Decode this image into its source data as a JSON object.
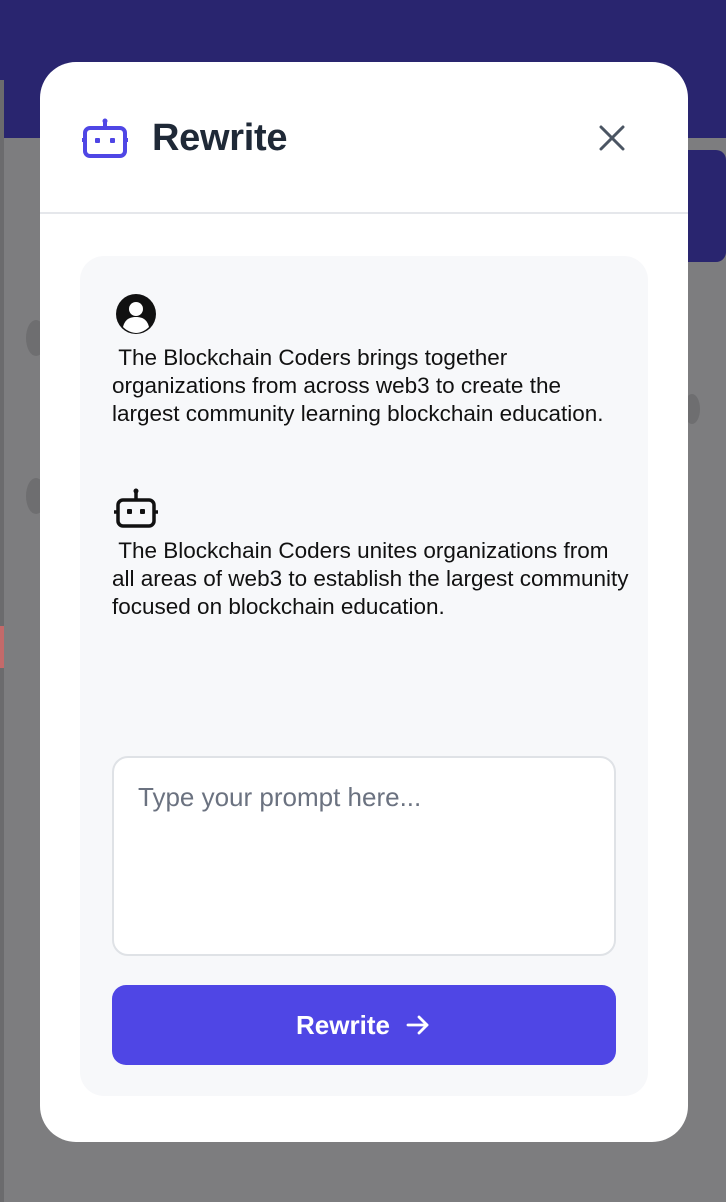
{
  "modal": {
    "title": "Rewrite",
    "close_icon": "close-icon",
    "header_icon": "robot-icon"
  },
  "conversation": [
    {
      "role": "user",
      "icon": "user-avatar-icon",
      "text": " The Blockchain Coders brings together organizations from across web3 to create the largest community learning blockchain education."
    },
    {
      "role": "assistant",
      "icon": "robot-icon",
      "text": " The Blockchain Coders unites organizations from all areas of web3 to establish the largest community focused on blockchain education."
    }
  ],
  "prompt": {
    "placeholder": "Type your prompt here...",
    "value": ""
  },
  "submit": {
    "label": "Rewrite",
    "icon": "arrow-right-icon"
  },
  "colors": {
    "accent": "#4f46e5",
    "title": "#1f2937",
    "panel": "#f7f8fa",
    "backdrop": "#7d7d7f",
    "app_header": "#29256f"
  }
}
